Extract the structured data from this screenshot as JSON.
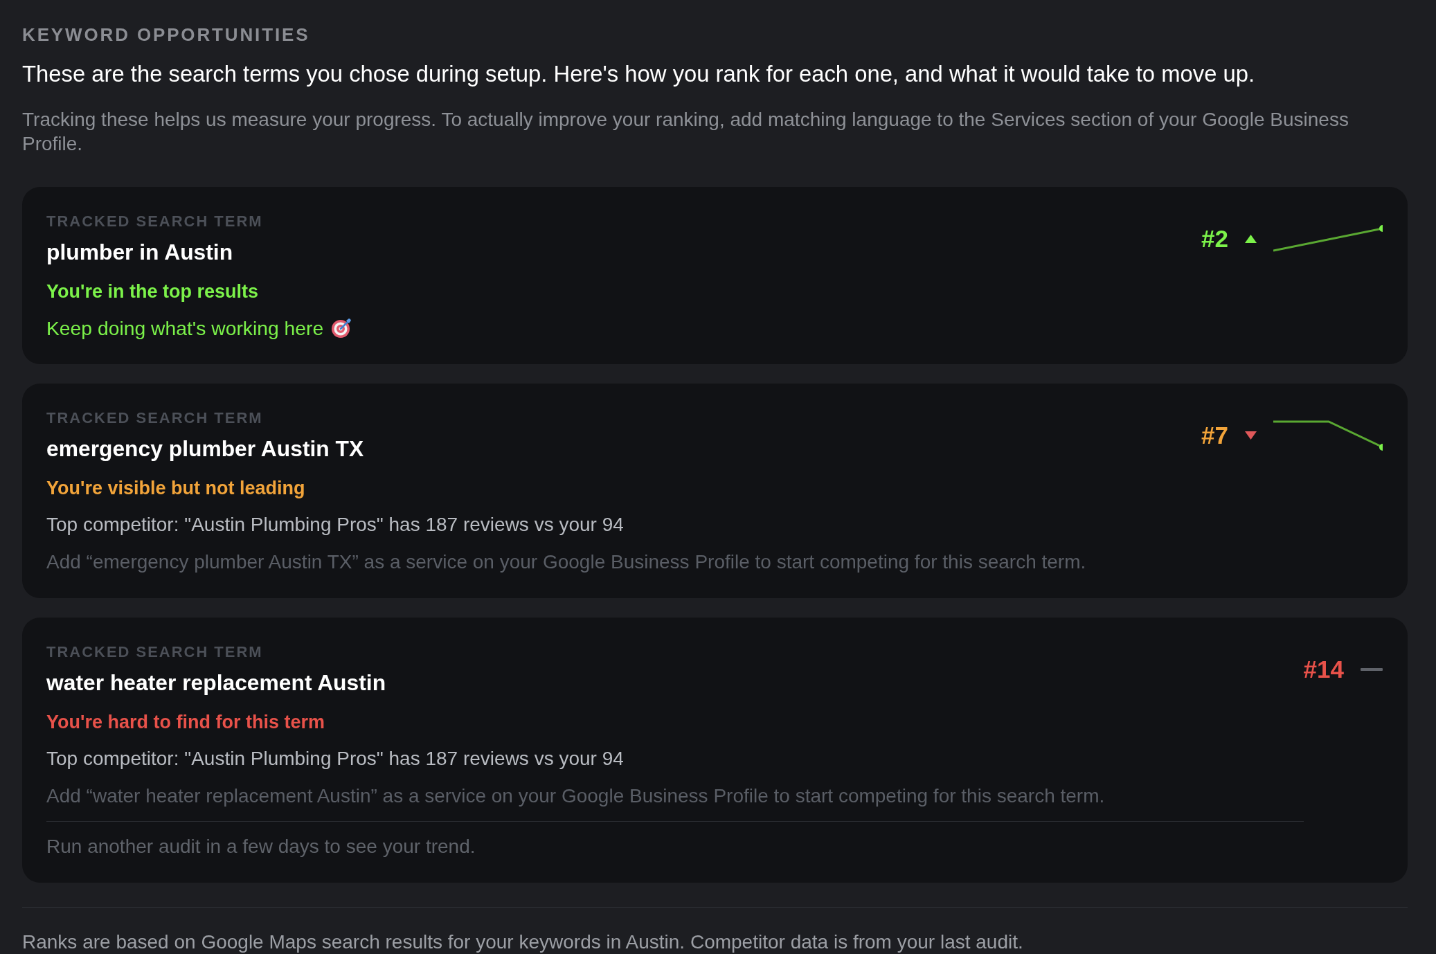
{
  "section_title": "KEYWORD OPPORTUNITIES",
  "intro": "These are the search terms you chose during setup. Here's how you rank for each one, and what it would take to move up.",
  "description": "Tracking these helps us measure your progress. To actually improve your ranking, add matching language to the Services section of your Google Business Profile.",
  "terms": [
    {
      "kind": "up",
      "label": "TRACKED SEARCH TERM",
      "term": "plumber in Austin",
      "rank": "#2",
      "color": "#7cf24a",
      "status": "You're in the top results",
      "details": [
        {
          "kind": "tip",
          "text": "Keep doing what's working here"
        }
      ]
    },
    {
      "kind": "down",
      "label": "TRACKED SEARCH TERM",
      "term": "emergency plumber Austin TX",
      "rank": "#7",
      "color": "#f2a43a",
      "status": "You're visible but not leading",
      "details": [
        {
          "kind": "competitor",
          "text": "Top competitor: \"Austin Plumbing Pros\" has 187 reviews vs your 94"
        },
        {
          "kind": "action",
          "text": "Add “emergency plumber Austin TX” as a service on your Google Business Profile to start competing for this search term."
        }
      ]
    },
    {
      "kind": "flat",
      "label": "TRACKED SEARCH TERM",
      "term": "water heater replacement Austin",
      "rank": "#14",
      "color": "#e8524a",
      "status": "You're hard to find for this term",
      "details": [
        {
          "kind": "competitor",
          "text": "Top competitor: \"Austin Plumbing Pros\" has 187 reviews vs your 94"
        },
        {
          "kind": "action",
          "text": "Add “water heater replacement Austin” as a service on your Google Business Profile to start competing for this search term."
        },
        {
          "kind": "footnote",
          "text": "Run another audit in a few days to see your trend."
        }
      ]
    }
  ],
  "footer": "Ranks are based on Google Maps search results for your keywords in Austin. Competitor data is from your last audit."
}
